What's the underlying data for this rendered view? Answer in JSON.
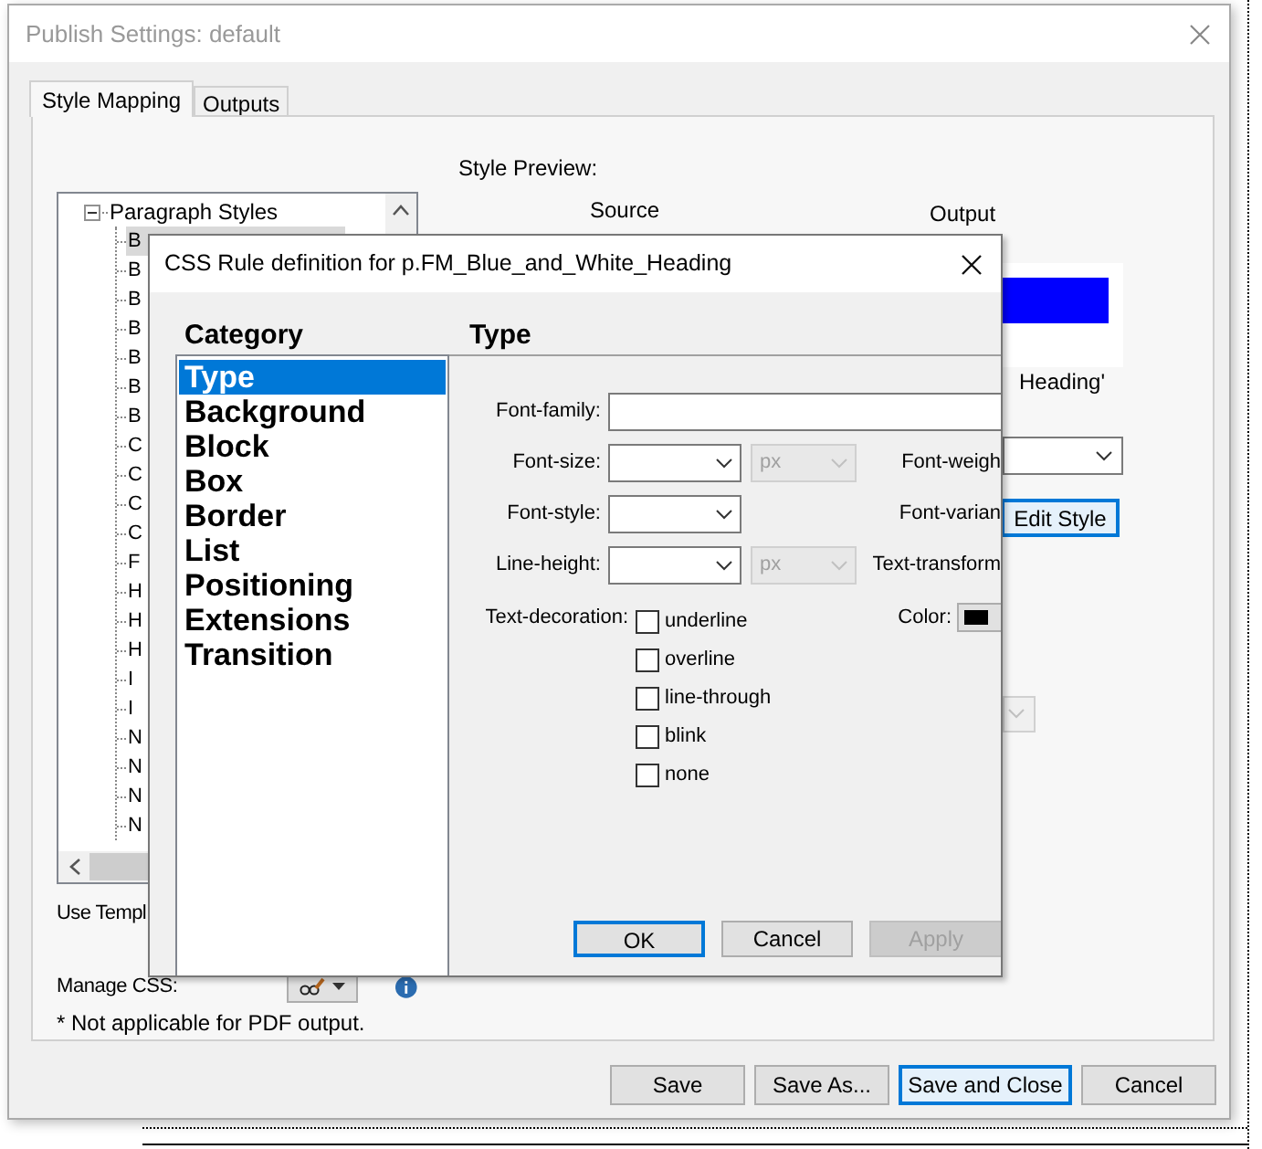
{
  "window": {
    "title": "Publish Settings: default"
  },
  "tabs": [
    {
      "label": "Style Mapping",
      "selected": true
    },
    {
      "label": "Outputs",
      "selected": false
    }
  ],
  "style_tree": {
    "label": "Paragraph Styles",
    "expanded": true,
    "children": [
      {
        "label": "B",
        "selected": true
      },
      {
        "label": "B",
        "selected": false
      },
      {
        "label": "B",
        "selected": false
      },
      {
        "label": "B",
        "selected": false
      },
      {
        "label": "B",
        "selected": false
      },
      {
        "label": "B",
        "selected": false
      },
      {
        "label": "B",
        "selected": false
      },
      {
        "label": "C",
        "selected": false
      },
      {
        "label": "C",
        "selected": false
      },
      {
        "label": "C",
        "selected": false
      },
      {
        "label": "C",
        "selected": false
      },
      {
        "label": "F",
        "selected": false
      },
      {
        "label": "H",
        "selected": false
      },
      {
        "label": "H",
        "selected": false
      },
      {
        "label": "H",
        "selected": false
      },
      {
        "label": "I",
        "selected": false
      },
      {
        "label": "I",
        "selected": false
      },
      {
        "label": "N",
        "selected": false
      },
      {
        "label": "N",
        "selected": false
      },
      {
        "label": "N",
        "selected": false
      },
      {
        "label": "N",
        "selected": false
      }
    ]
  },
  "preview": {
    "heading": "Style Preview:",
    "source_label": "Source",
    "output_label": "Output",
    "caption": "Heading'"
  },
  "style_dropdown": {
    "disabled": false
  },
  "edit_style_button": {
    "label": "Edit Style",
    "focused": true
  },
  "second_dropdown": {
    "disabled": true
  },
  "use_template_label": "Use Templ",
  "manage_css_label": "Manage CSS:",
  "note": "* Not applicable for PDF output.",
  "buttons": [
    {
      "label": "Save",
      "focused": false
    },
    {
      "label": "Save As...",
      "focused": false
    },
    {
      "label": "Save and Close",
      "focused": true
    },
    {
      "label": "Cancel",
      "focused": false
    }
  ],
  "css_dialog": {
    "title": "CSS Rule definition for p.FM_Blue_and_White_Heading",
    "category_heading": "Category",
    "categories": [
      {
        "label": "Type",
        "selected": true
      },
      {
        "label": "Background",
        "selected": false
      },
      {
        "label": "Block",
        "selected": false
      },
      {
        "label": "Box",
        "selected": false
      },
      {
        "label": "Border",
        "selected": false
      },
      {
        "label": "List",
        "selected": false
      },
      {
        "label": "Positioning",
        "selected": false
      },
      {
        "label": "Extensions",
        "selected": false
      },
      {
        "label": "Transition",
        "selected": false
      }
    ],
    "panel_heading": "Type",
    "fields": [
      {
        "kind": "text",
        "label": "Font-family:"
      },
      {
        "kind": "select_unit",
        "label": "Font-size:",
        "unit": "px",
        "unit_disabled": true,
        "side_label": "Font-weigh"
      },
      {
        "kind": "select",
        "label": "Font-style:",
        "side_label": "Font-varian"
      },
      {
        "kind": "select_unit",
        "label": "Line-height:",
        "unit": "px",
        "unit_disabled": true,
        "side_label": "Text-transform"
      }
    ],
    "text_decoration": {
      "label": "Text-decoration:",
      "options": [
        {
          "label": "underline",
          "checked": false
        },
        {
          "label": "overline",
          "checked": false
        },
        {
          "label": "line-through",
          "checked": false
        },
        {
          "label": "blink",
          "checked": false
        },
        {
          "label": "none",
          "checked": false
        }
      ]
    },
    "color": {
      "label": "Color:"
    },
    "buttons": [
      {
        "label": "OK",
        "focused": true,
        "disabled": false
      },
      {
        "label": "Cancel",
        "focused": false,
        "disabled": false
      },
      {
        "label": "Apply",
        "focused": false,
        "disabled": true
      }
    ]
  }
}
